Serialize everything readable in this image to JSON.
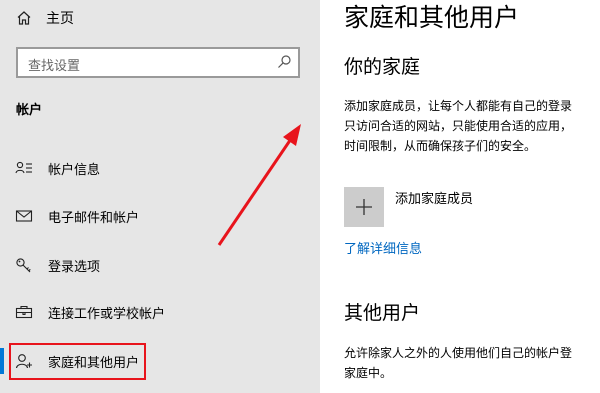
{
  "sidebar": {
    "home_label": "主页",
    "search_placeholder": "查找设置",
    "section_title": "帐户",
    "items": [
      {
        "label": "帐户信息",
        "icon": "account-info-icon"
      },
      {
        "label": "电子邮件和帐户",
        "icon": "mail-icon"
      },
      {
        "label": "登录选项",
        "icon": "key-icon"
      },
      {
        "label": "连接工作或学校帐户",
        "icon": "briefcase-icon"
      },
      {
        "label": "家庭和其他用户",
        "icon": "person-add-icon",
        "selected": true
      }
    ]
  },
  "main": {
    "title": "家庭和其他用户",
    "family": {
      "heading": "你的家庭",
      "description_lines": [
        "添加家庭成员，让每个人都能有自己的登录",
        "只访问合适的网站，只能使用合适的应用，",
        "时间限制，从而确保孩子们的安全。"
      ],
      "add_label": "添加家庭成员",
      "learn_more": "了解详细信息"
    },
    "other_users": {
      "heading": "其他用户",
      "description_lines": [
        "允许除家人之外的人使用他们自己的帐户登",
        "家庭中。"
      ]
    }
  },
  "colors": {
    "sidebar_bg": "#e6e6e6",
    "accent": "#0078d7",
    "link": "#0067c0",
    "highlight_red": "#e8141c"
  }
}
